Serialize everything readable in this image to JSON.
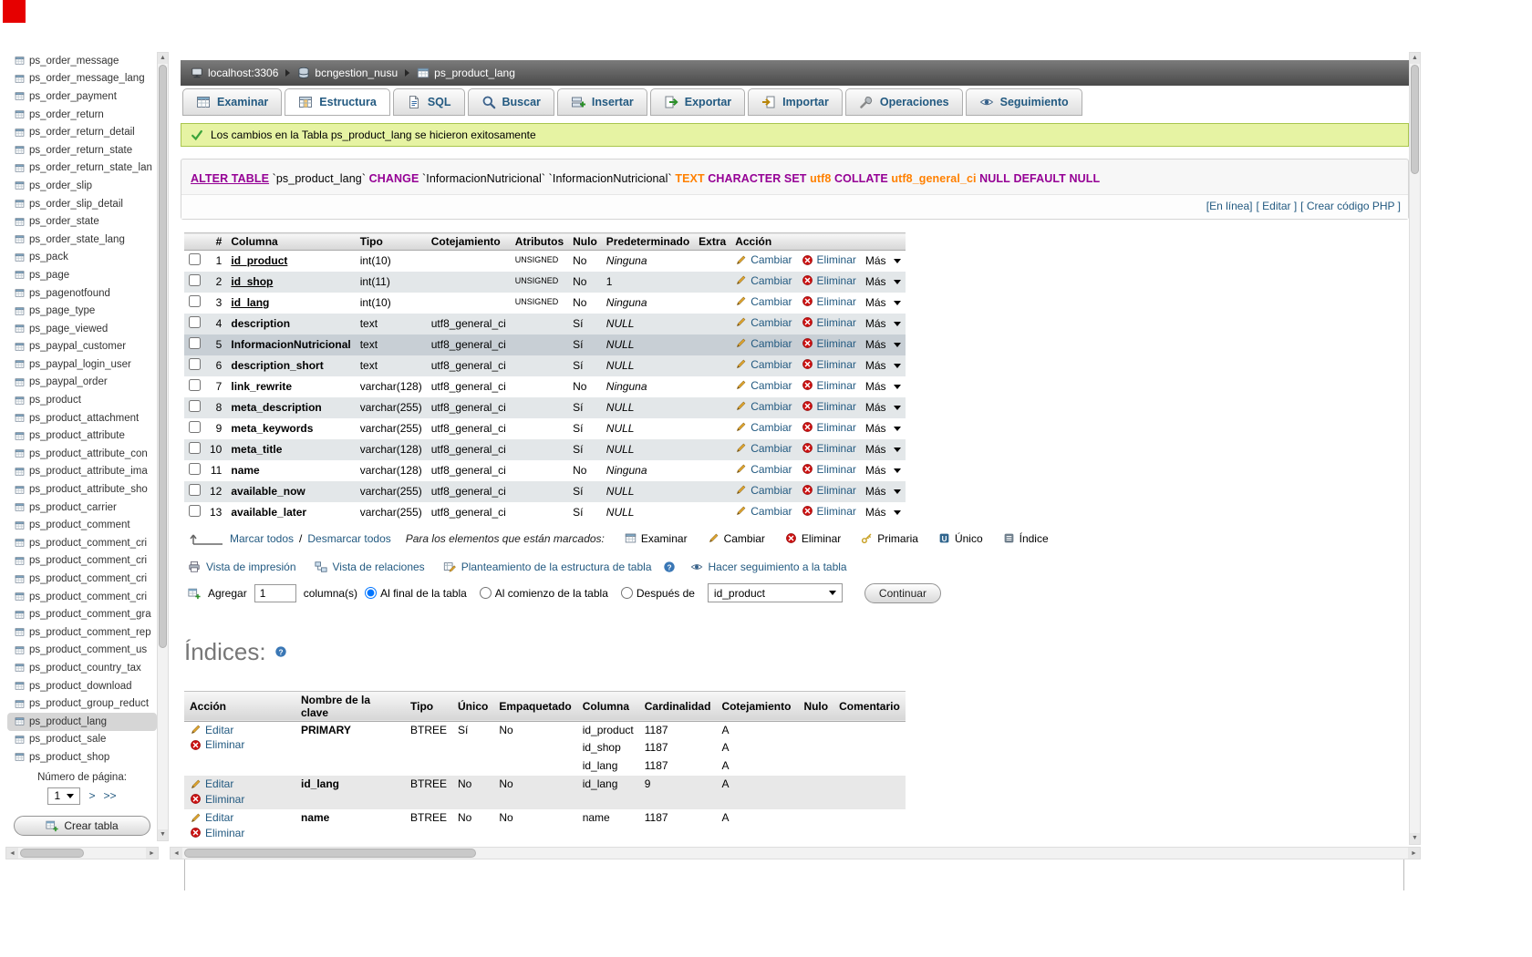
{
  "sidebar": {
    "items": [
      "ps_order_message",
      "ps_order_message_lang",
      "ps_order_payment",
      "ps_order_return",
      "ps_order_return_detail",
      "ps_order_return_state",
      "ps_order_return_state_lan",
      "ps_order_slip",
      "ps_order_slip_detail",
      "ps_order_state",
      "ps_order_state_lang",
      "ps_pack",
      "ps_page",
      "ps_pagenotfound",
      "ps_page_type",
      "ps_page_viewed",
      "ps_paypal_customer",
      "ps_paypal_login_user",
      "ps_paypal_order",
      "ps_product",
      "ps_product_attachment",
      "ps_product_attribute",
      "ps_product_attribute_con",
      "ps_product_attribute_ima",
      "ps_product_attribute_sho",
      "ps_product_carrier",
      "ps_product_comment",
      "ps_product_comment_cri",
      "ps_product_comment_cri",
      "ps_product_comment_cri",
      "ps_product_comment_cri",
      "ps_product_comment_gra",
      "ps_product_comment_rep",
      "ps_product_comment_us",
      "ps_product_country_tax",
      "ps_product_download",
      "ps_product_group_reduct",
      "ps_product_lang",
      "ps_product_sale",
      "ps_product_shop"
    ],
    "selected_index": 37,
    "page_label": "Número de página:",
    "page_value": "1",
    "next_label": ">",
    "last_label": ">>",
    "create_table_label": "Crear tabla"
  },
  "breadcrumb": {
    "server": "localhost:3306",
    "database": "bcngestion_nusu",
    "table": "ps_product_lang"
  },
  "tabs": {
    "items": [
      {
        "label": "Examinar"
      },
      {
        "label": "Estructura",
        "active": true
      },
      {
        "label": "SQL"
      },
      {
        "label": "Buscar"
      },
      {
        "label": "Insertar"
      },
      {
        "label": "Exportar"
      },
      {
        "label": "Importar"
      },
      {
        "label": "Operaciones"
      },
      {
        "label": "Seguimiento"
      }
    ]
  },
  "success": {
    "text": "Los cambios en la Tabla ps_product_lang se hicieron exitosamente"
  },
  "sql": {
    "tokens": [
      {
        "t": "ALTER TABLE",
        "c": "kwl"
      },
      {
        "t": " `ps_product_lang` ",
        "c": "id"
      },
      {
        "t": "CHANGE",
        "c": "kw"
      },
      {
        "t": " `InformacionNutricional` `InformacionNutricional` ",
        "c": "id"
      },
      {
        "t": "TEXT",
        "c": "ty"
      },
      {
        "t": " ",
        "c": "id"
      },
      {
        "t": "CHARACTER SET",
        "c": "kw"
      },
      {
        "t": " ",
        "c": "id"
      },
      {
        "t": "utf8",
        "c": "ty"
      },
      {
        "t": " ",
        "c": "id"
      },
      {
        "t": "COLLATE",
        "c": "kw"
      },
      {
        "t": " ",
        "c": "id"
      },
      {
        "t": "utf8_general_ci",
        "c": "ty"
      },
      {
        "t": " ",
        "c": "id"
      },
      {
        "t": "NULL",
        "c": "kw"
      },
      {
        "t": " ",
        "c": "id"
      },
      {
        "t": "DEFAULT",
        "c": "kw"
      },
      {
        "t": " ",
        "c": "id"
      },
      {
        "t": "NULL",
        "c": "kw"
      }
    ],
    "links": [
      "[En línea]",
      "[ Editar ]",
      "[ Crear código PHP ]"
    ]
  },
  "structure": {
    "headers": [
      "#",
      "Columna",
      "Tipo",
      "Cotejamiento",
      "Atributos",
      "Nulo",
      "Predeterminado",
      "Extra",
      "Acción"
    ],
    "actions": {
      "change": "Cambiar",
      "drop": "Eliminar",
      "more": "Más"
    },
    "rows": [
      {
        "num": 1,
        "name": "id_product",
        "key": true,
        "type": "int(10)",
        "collation": "",
        "attributes": "UNSIGNED",
        "null": "No",
        "default": "Ninguna",
        "extra": "",
        "highlight": false
      },
      {
        "num": 2,
        "name": "id_shop",
        "key": true,
        "type": "int(11)",
        "collation": "",
        "attributes": "UNSIGNED",
        "null": "No",
        "default": "1",
        "extra": "",
        "highlight": false
      },
      {
        "num": 3,
        "name": "id_lang",
        "key": true,
        "type": "int(10)",
        "collation": "",
        "attributes": "UNSIGNED",
        "null": "No",
        "default": "Ninguna",
        "extra": "",
        "highlight": false
      },
      {
        "num": 4,
        "name": "description",
        "key": false,
        "type": "text",
        "collation": "utf8_general_ci",
        "attributes": "",
        "null": "Sí",
        "default": "NULL",
        "extra": "",
        "highlight": false
      },
      {
        "num": 5,
        "name": "InformacionNutricional",
        "key": false,
        "type": "text",
        "collation": "utf8_general_ci",
        "attributes": "",
        "null": "Sí",
        "default": "NULL",
        "extra": "",
        "highlight": true
      },
      {
        "num": 6,
        "name": "description_short",
        "key": false,
        "type": "text",
        "collation": "utf8_general_ci",
        "attributes": "",
        "null": "Sí",
        "default": "NULL",
        "extra": "",
        "highlight": false
      },
      {
        "num": 7,
        "name": "link_rewrite",
        "key": false,
        "type": "varchar(128)",
        "collation": "utf8_general_ci",
        "attributes": "",
        "null": "No",
        "default": "Ninguna",
        "extra": "",
        "highlight": false
      },
      {
        "num": 8,
        "name": "meta_description",
        "key": false,
        "type": "varchar(255)",
        "collation": "utf8_general_ci",
        "attributes": "",
        "null": "Sí",
        "default": "NULL",
        "extra": "",
        "highlight": false
      },
      {
        "num": 9,
        "name": "meta_keywords",
        "key": false,
        "type": "varchar(255)",
        "collation": "utf8_general_ci",
        "attributes": "",
        "null": "Sí",
        "default": "NULL",
        "extra": "",
        "highlight": false
      },
      {
        "num": 10,
        "name": "meta_title",
        "key": false,
        "type": "varchar(128)",
        "collation": "utf8_general_ci",
        "attributes": "",
        "null": "Sí",
        "default": "NULL",
        "extra": "",
        "highlight": false
      },
      {
        "num": 11,
        "name": "name",
        "key": false,
        "type": "varchar(128)",
        "collation": "utf8_general_ci",
        "attributes": "",
        "null": "No",
        "default": "Ninguna",
        "extra": "",
        "highlight": false
      },
      {
        "num": 12,
        "name": "available_now",
        "key": false,
        "type": "varchar(255)",
        "collation": "utf8_general_ci",
        "attributes": "",
        "null": "Sí",
        "default": "NULL",
        "extra": "",
        "highlight": false
      },
      {
        "num": 13,
        "name": "available_later",
        "key": false,
        "type": "varchar(255)",
        "collation": "utf8_general_ci",
        "attributes": "",
        "null": "Sí",
        "default": "NULL",
        "extra": "",
        "highlight": false
      }
    ]
  },
  "checkall": {
    "mark_all": "Marcar todos",
    "separator": "/",
    "unmark_all": "Desmarcar todos",
    "with_selected": "Para los elementos que están marcados:",
    "buttons": [
      "Examinar",
      "Cambiar",
      "Eliminar",
      "Primaria",
      "Único",
      "Índice"
    ]
  },
  "tools": {
    "print": "Vista de impresión",
    "relations": "Vista de relaciones",
    "propose": "Planteamiento de la estructura de tabla",
    "track": "Hacer seguimiento a la tabla"
  },
  "addcol": {
    "add_label": "Agregar",
    "count": "1",
    "columns_label": "columna(s)",
    "options": [
      "Al final de la tabla",
      "Al comienzo de la tabla",
      "Después de"
    ],
    "selected_option": 0,
    "after_value": "id_product",
    "continue_label": "Continuar"
  },
  "indexes": {
    "title": "Índices:",
    "headers": [
      "Acción",
      "Nombre de la clave",
      "Tipo",
      "Único",
      "Empaquetado",
      "Columna",
      "Cardinalidad",
      "Cotejamiento",
      "Nulo",
      "Comentario"
    ],
    "edit_label": "Editar",
    "drop_label": "Eliminar",
    "rows": [
      {
        "name": "PRIMARY",
        "type": "BTREE",
        "unique": "Sí",
        "packed": "No",
        "shaded": false,
        "columns": [
          {
            "column": "id_product",
            "cardinality": "1187",
            "collation": "A"
          },
          {
            "column": "id_shop",
            "cardinality": "1187",
            "collation": "A"
          },
          {
            "column": "id_lang",
            "cardinality": "1187",
            "collation": "A"
          }
        ]
      },
      {
        "name": "id_lang",
        "type": "BTREE",
        "unique": "No",
        "packed": "No",
        "shaded": true,
        "columns": [
          {
            "column": "id_lang",
            "cardinality": "9",
            "collation": "A"
          }
        ]
      },
      {
        "name": "name",
        "type": "BTREE",
        "unique": "No",
        "packed": "No",
        "shaded": false,
        "columns": [
          {
            "column": "name",
            "cardinality": "1187",
            "collation": "A"
          }
        ]
      }
    ]
  }
}
